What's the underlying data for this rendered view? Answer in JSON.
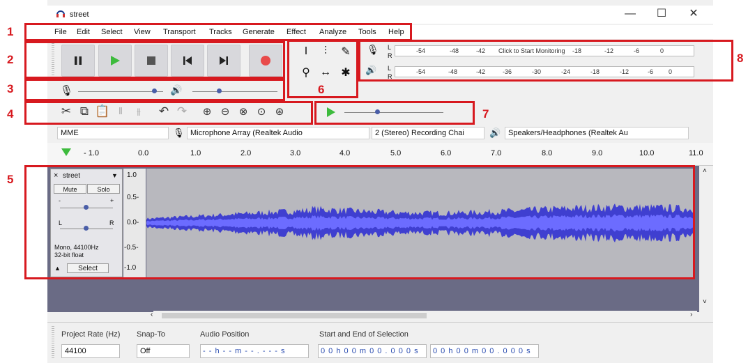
{
  "window": {
    "title": "street",
    "min_glyph": "—",
    "max_glyph": "☐",
    "close_glyph": "✕"
  },
  "menu": [
    "File",
    "Edit",
    "Select",
    "View",
    "Transport",
    "Tracks",
    "Generate",
    "Effect",
    "Analyze",
    "Tools",
    "Help"
  ],
  "meters": {
    "record_scale": [
      "-54",
      "-48",
      "-42",
      "-18",
      "-12",
      "-6",
      "0"
    ],
    "record_prompt": "Click to Start Monitoring",
    "playback_scale": [
      "-54",
      "-48",
      "-42",
      "-36",
      "-30",
      "-24",
      "-18",
      "-12",
      "-6",
      "0"
    ],
    "L": "L",
    "R": "R"
  },
  "devices": {
    "host": "MME",
    "recording_device": "Microphone Array (Realtek Audio",
    "channels": "2 (Stereo) Recording Chai",
    "playback_device": "Speakers/Headphones (Realtek Au"
  },
  "ruler": {
    "labels": [
      "- 1.0",
      "0.0",
      "1.0",
      "2.0",
      "3.0",
      "4.0",
      "5.0",
      "6.0",
      "7.0",
      "8.0",
      "9.0",
      "10.0",
      "11.0"
    ]
  },
  "track": {
    "close": "×",
    "name": "street",
    "mute": "Mute",
    "solo": "Solo",
    "gain_minus": "-",
    "gain_plus": "+",
    "pan_left": "L",
    "pan_right": "R",
    "info_line1": "Mono, 44100Hz",
    "info_line2": "32-bit float",
    "select": "Select",
    "scale": [
      "1.0",
      "0.5-",
      "0.0-",
      "-0.5-",
      "-1.0"
    ]
  },
  "selection_toolbar": {
    "project_rate_label": "Project Rate (Hz)",
    "project_rate_value": "44100",
    "snap_label": "Snap-To",
    "snap_value": "Off",
    "audio_position_label": "Audio Position",
    "audio_position_value": "- - h - - m - - . - - - s",
    "selection_label": "Start and End of Selection",
    "selection_start": "0 0 h 0 0 m 0 0 . 0 0 0 s",
    "selection_end": "0 0 h 0 0 m 0 0 . 0 0 0 s"
  },
  "annotations": [
    "1",
    "2",
    "3",
    "4",
    "5",
    "6",
    "7",
    "8"
  ],
  "colors": {
    "annotation": "#d7191f",
    "waveform": "#3f3fd0",
    "play": "#3dbb3d",
    "record": "#e84a4a"
  }
}
